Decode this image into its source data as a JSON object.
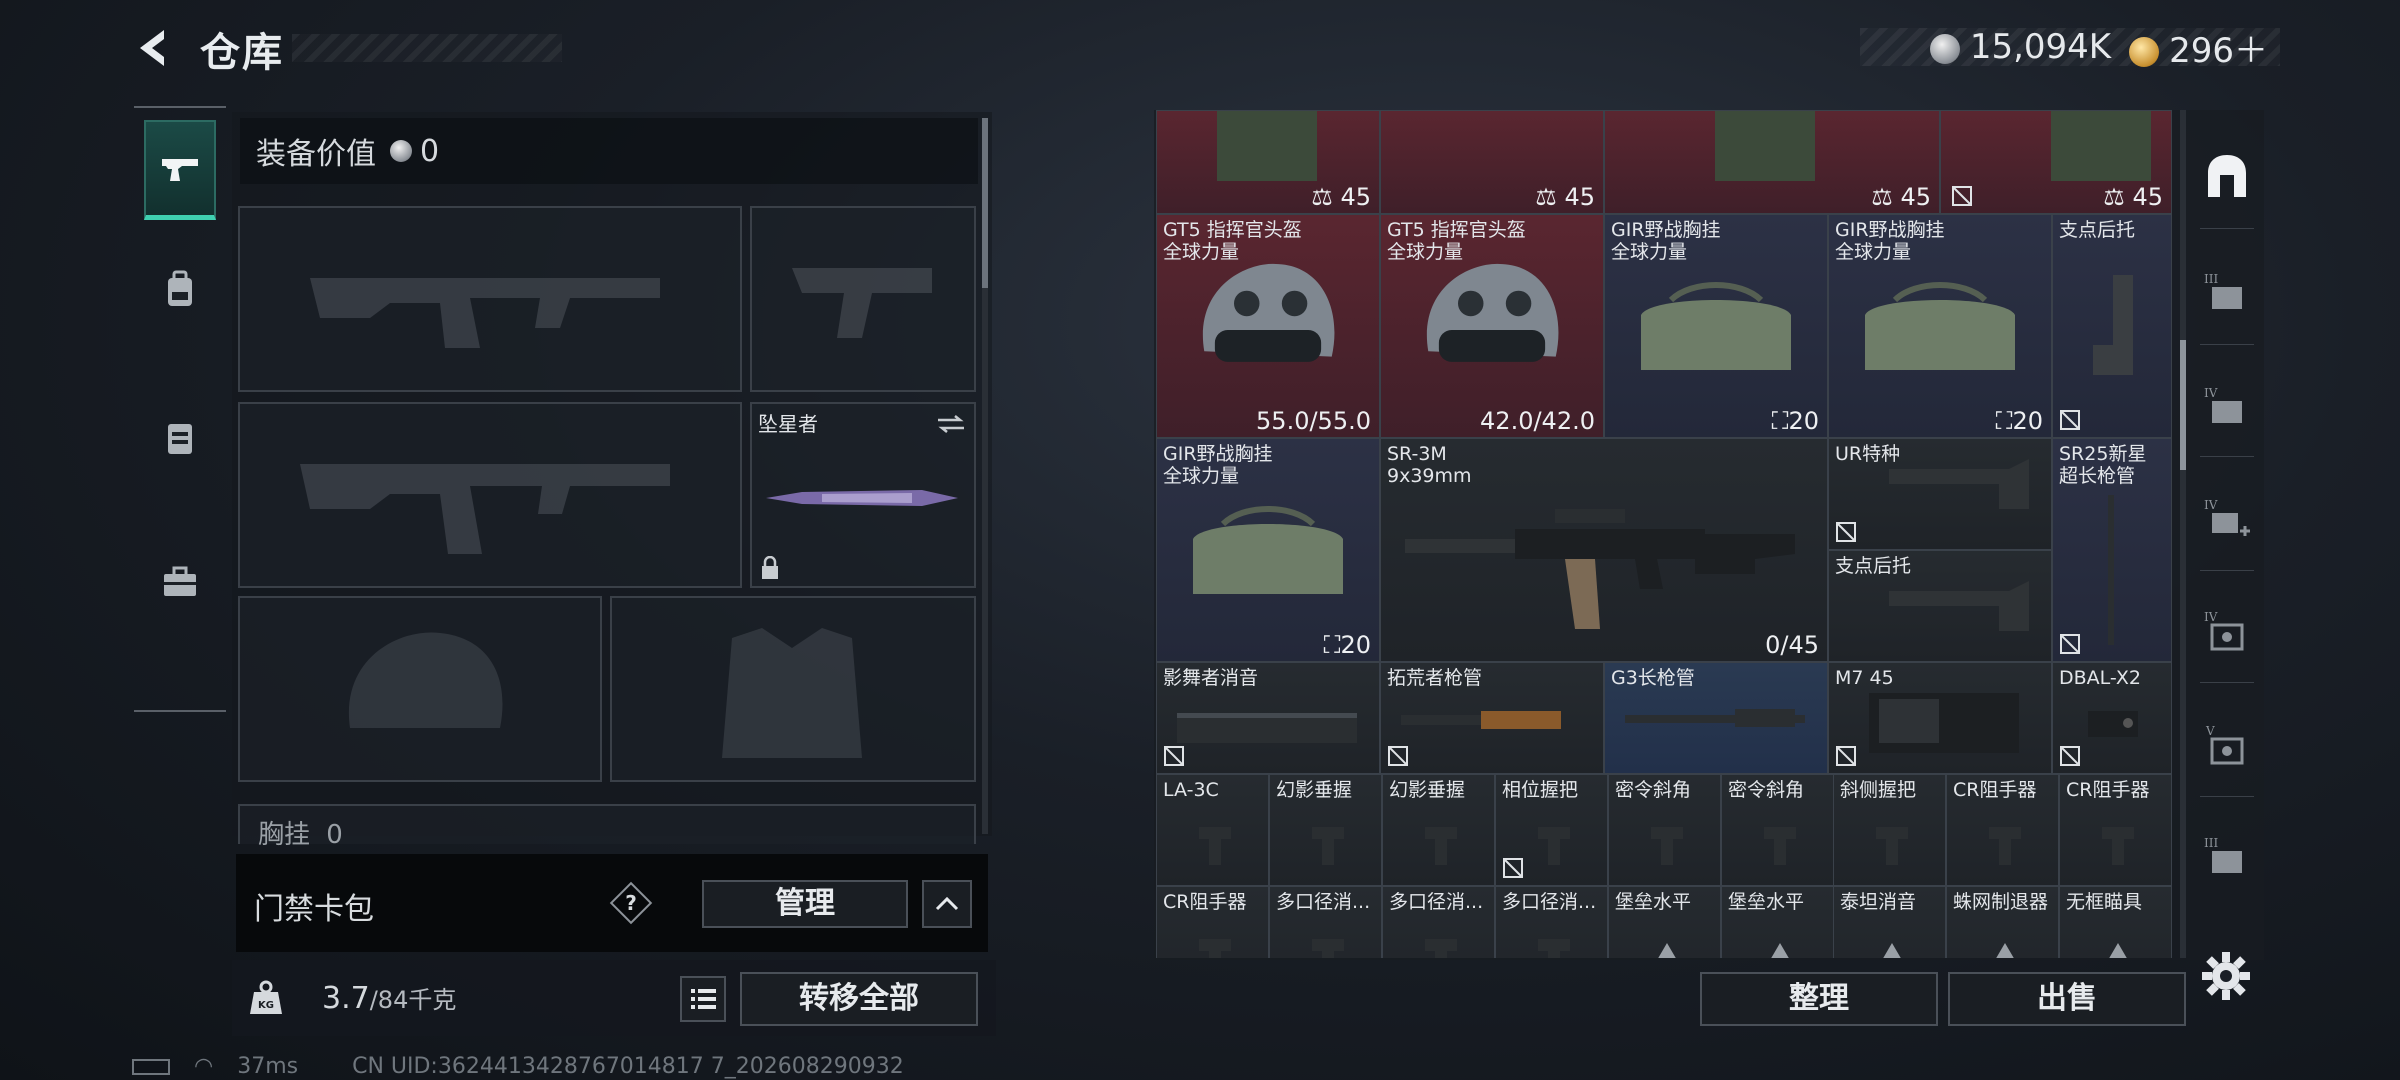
{
  "header": {
    "title": "仓库",
    "currency": [
      {
        "icon": "silver-coin-icon",
        "value": "15,094K"
      },
      {
        "icon": "gold-coin-icon",
        "value": "296＋"
      }
    ]
  },
  "categories": [
    {
      "icon": "pistol-icon",
      "active": true
    },
    {
      "icon": "backpack-icon",
      "active": false
    },
    {
      "icon": "vest-icon",
      "active": false
    },
    {
      "icon": "toolbox-icon",
      "active": false
    }
  ],
  "loadout": {
    "equip_value_label": "装备价值",
    "equip_value": "0",
    "melee_name": "坠星者",
    "chest_label": "胸挂",
    "chest_count": "0"
  },
  "keycard": {
    "label": "门禁卡包",
    "help": "?",
    "manage": "管理"
  },
  "weight": {
    "current": "3.7",
    "max": "/84千克",
    "icon_label": "KG",
    "transfer_all": "转移全部"
  },
  "status": {
    "ping": "37ms",
    "uid": "CN UID:3624413428767014817 7_202608290932"
  },
  "stash": {
    "top_row": [
      {
        "value": "45",
        "icon": "weight-icon"
      },
      {
        "value": "45",
        "icon": "weight-icon"
      },
      {
        "value": "45",
        "icon": "weight-icon"
      }
    ],
    "items": [
      {
        "id": "helmet1",
        "name": "GT5 指挥官头盔",
        "sub": "全球力量",
        "value": "55.0/55.0"
      },
      {
        "id": "helmet2",
        "name": "GT5 指挥官头盔",
        "sub": "全球力量",
        "value": "42.0/42.0"
      },
      {
        "id": "rig1",
        "name": "GIR野战胸挂",
        "sub": "全球力量",
        "value": "20"
      },
      {
        "id": "rig2",
        "name": "GIR野战胸挂",
        "sub": "全球力量",
        "value": "20"
      },
      {
        "id": "stock1",
        "name": "支点后托",
        "sub": ""
      },
      {
        "id": "rig3",
        "name": "GIR野战胸挂",
        "sub": "全球力量",
        "value": "20"
      },
      {
        "id": "sr3m",
        "name": "SR-3M",
        "sub": "9x39mm",
        "value": "0/45"
      },
      {
        "id": "ur",
        "name": "UR特种",
        "sub": ""
      },
      {
        "id": "stock2",
        "name": "支点后托",
        "sub": ""
      },
      {
        "id": "sr25",
        "name": "SR25新星",
        "sub": "超长枪管"
      },
      {
        "id": "sup1",
        "name": "影舞者消音"
      },
      {
        "id": "barrel1",
        "name": "拓荒者枪管"
      },
      {
        "id": "barrel2",
        "name": "G3长枪管"
      },
      {
        "id": "mag",
        "name": "M7 45"
      },
      {
        "id": "dbal",
        "name": "DBAL-X2"
      },
      {
        "id": "la3c",
        "name": "LA-3C"
      },
      {
        "id": "grip1",
        "name": "幻影垂握"
      },
      {
        "id": "grip2",
        "name": "幻影垂握"
      },
      {
        "id": "grip3",
        "name": "相位握把"
      },
      {
        "id": "grip4",
        "name": "密令斜角"
      },
      {
        "id": "grip5",
        "name": "密令斜角"
      },
      {
        "id": "grip6",
        "name": "斜侧握把"
      },
      {
        "id": "grip7",
        "name": "CR阻手器"
      },
      {
        "id": "grip8",
        "name": "CR阻手器"
      },
      {
        "id": "r1",
        "name": "CR阻手器"
      },
      {
        "id": "r2",
        "name": "多口径消..."
      },
      {
        "id": "r3",
        "name": "多口径消..."
      },
      {
        "id": "r4",
        "name": "多口径消..."
      },
      {
        "id": "r5",
        "name": "堡垒水平"
      },
      {
        "id": "r6",
        "name": "堡垒水平"
      },
      {
        "id": "r7",
        "name": "泰坦消音"
      },
      {
        "id": "r8",
        "name": "蛛网制退器"
      },
      {
        "id": "r9",
        "name": "无框瞄具"
      }
    ],
    "sort": "整理",
    "sell": "出售"
  },
  "rail": [
    {
      "icon": "stash-home-icon"
    },
    {
      "icon": "tier3-expand-icon",
      "label": "III"
    },
    {
      "icon": "tier4-folder-icon",
      "label": "IV"
    },
    {
      "icon": "tier4-plus-icon",
      "label": "IV"
    },
    {
      "icon": "tier4-safe-icon",
      "label": "IV"
    },
    {
      "icon": "tier5-safe-icon",
      "label": "V"
    },
    {
      "icon": "tier3-box-icon",
      "label": "III"
    }
  ],
  "colors": {
    "accent": "#3fd0b0",
    "rare_red": "#5a2630",
    "epic_blue": "#2c3145"
  }
}
